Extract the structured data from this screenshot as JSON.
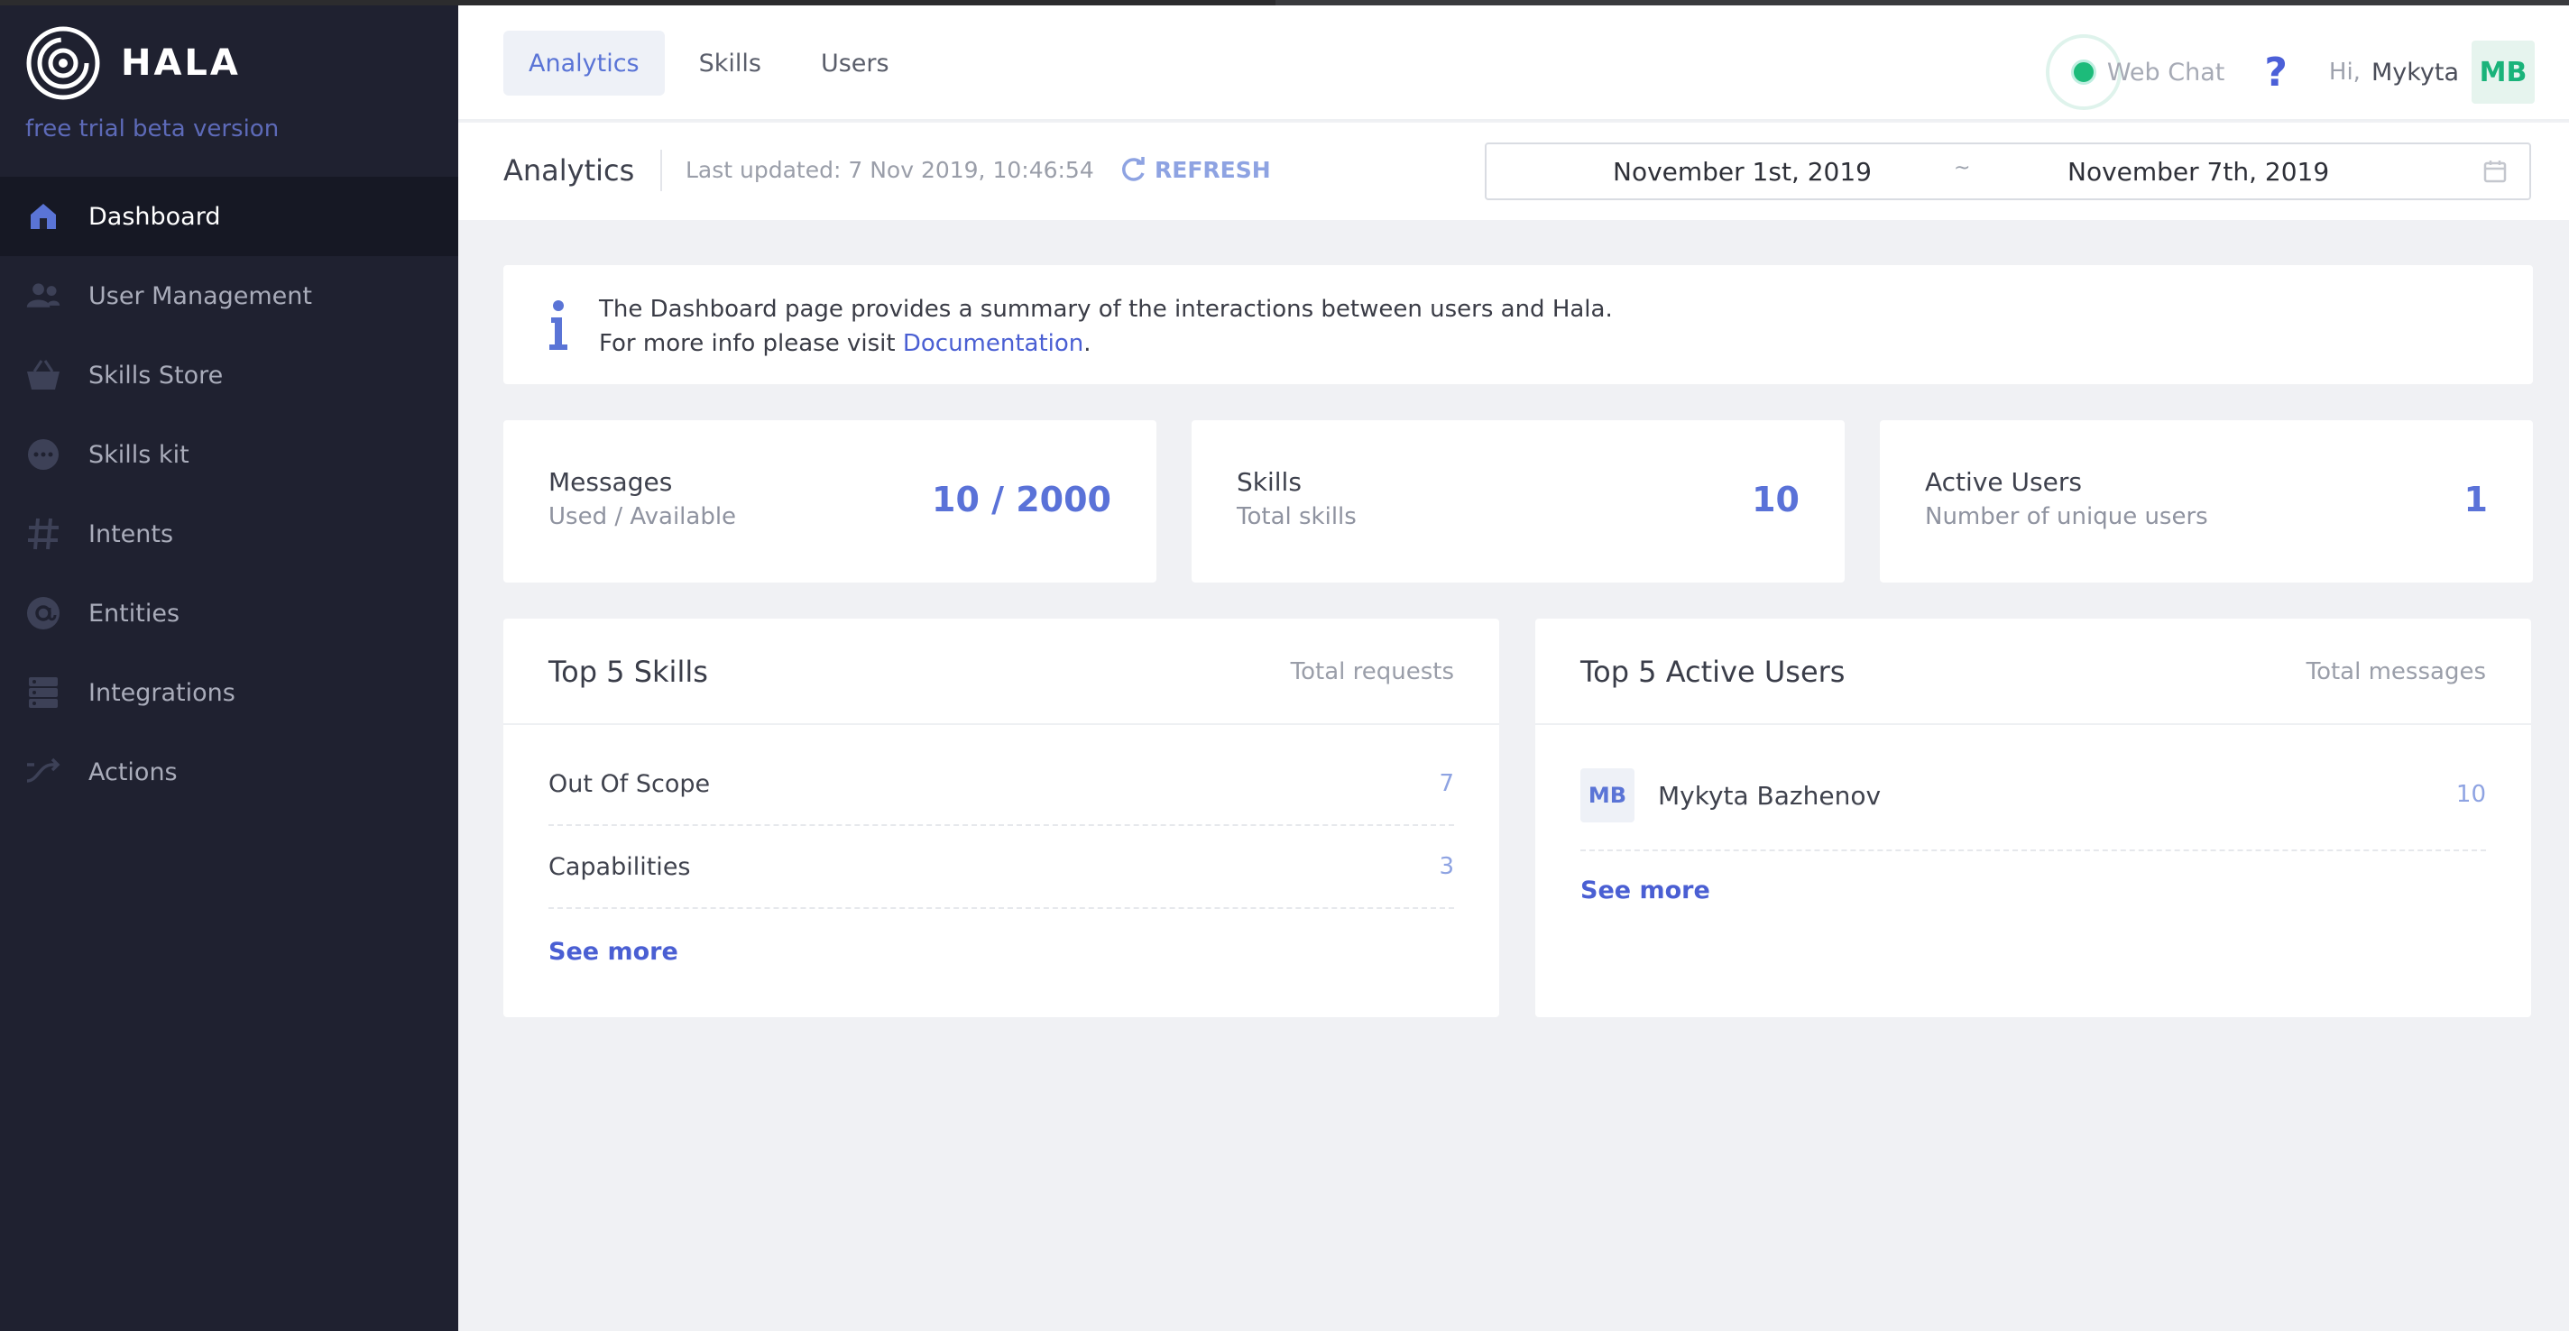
{
  "app": {
    "brand": "HALA",
    "subtitle": "free trial beta version"
  },
  "sidebar": {
    "items": [
      {
        "label": "Dashboard",
        "icon": "home-icon",
        "active": true
      },
      {
        "label": "User Management",
        "icon": "users-icon"
      },
      {
        "label": "Skills Store",
        "icon": "basket-icon"
      },
      {
        "label": "Skills kit",
        "icon": "chat-bubble-icon"
      },
      {
        "label": "Intents",
        "icon": "hash-icon"
      },
      {
        "label": "Entities",
        "icon": "at-icon"
      },
      {
        "label": "Integrations",
        "icon": "server-icon"
      },
      {
        "label": "Actions",
        "icon": "shuffle-icon"
      }
    ]
  },
  "header": {
    "tabs": [
      {
        "label": "Analytics",
        "active": true
      },
      {
        "label": "Skills"
      },
      {
        "label": "Users"
      }
    ],
    "webchat_label": "Web Chat",
    "help_glyph": "?",
    "greeting": "Hi,",
    "username": "Mykyta",
    "avatar_initials": "MB"
  },
  "subheader": {
    "title": "Analytics",
    "last_updated": "Last updated: 7 Nov 2019, 10:46:54",
    "refresh_label": "REFRESH",
    "date_start": "November 1st, 2019",
    "date_separator": "~",
    "date_end": "November 7th, 2019"
  },
  "info": {
    "line1": "The Dashboard page provides a summary of the interactions between users and Hala.",
    "line2_prefix": "For more info please visit ",
    "link_text": "Documentation",
    "line2_suffix": "."
  },
  "stats": [
    {
      "title": "Messages",
      "subtitle": "Used / Available",
      "value": "10 / 2000"
    },
    {
      "title": "Skills",
      "subtitle": "Total skills",
      "value": "10"
    },
    {
      "title": "Active Users",
      "subtitle": "Number of unique users",
      "value": "1"
    }
  ],
  "top_skills": {
    "title": "Top 5 Skills",
    "column": "Total requests",
    "rows": [
      {
        "label": "Out Of Scope",
        "value": "7"
      },
      {
        "label": "Capabilities",
        "value": "3"
      }
    ],
    "see_more": "See more"
  },
  "top_users": {
    "title": "Top 5 Active Users",
    "column": "Total messages",
    "rows": [
      {
        "initials": "MB",
        "name": "Mykyta Bazhenov",
        "value": "10"
      }
    ],
    "see_more": "See more"
  },
  "colors": {
    "sidebar_bg": "#1f2130",
    "accent": "#5a74d6",
    "link": "#4a5fd3",
    "online": "#1dbb7a"
  }
}
